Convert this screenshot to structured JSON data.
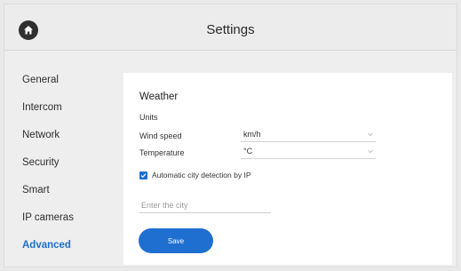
{
  "header": {
    "title": "Settings",
    "home_icon": "home-icon"
  },
  "sidebar": {
    "items": [
      {
        "label": "General",
        "active": false
      },
      {
        "label": "Intercom",
        "active": false
      },
      {
        "label": "Network",
        "active": false
      },
      {
        "label": "Security",
        "active": false
      },
      {
        "label": "Smart",
        "active": false
      },
      {
        "label": "IP cameras",
        "active": false
      },
      {
        "label": "Advanced",
        "active": true
      }
    ]
  },
  "weather": {
    "title": "Weather",
    "units_label": "Units",
    "wind_speed": {
      "label": "Wind speed",
      "value": "km/h"
    },
    "temperature": {
      "label": "Temperature",
      "value": "°C"
    },
    "auto_detect": {
      "label": "Automatic city detection by IP",
      "checked": true
    },
    "city": {
      "value": "",
      "placeholder": "Enter the city"
    },
    "save_label": "Save"
  },
  "colors": {
    "accent": "#1f6fd1",
    "panel": "#ffffff",
    "background": "#eeeeef"
  }
}
